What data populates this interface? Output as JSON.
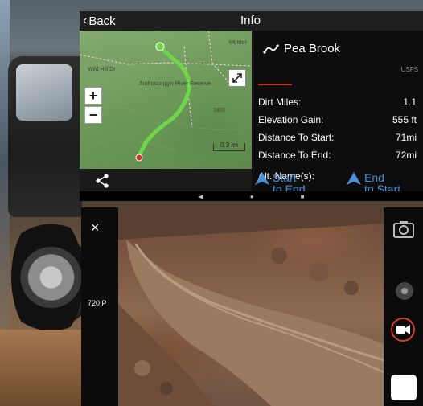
{
  "info_screen": {
    "header": {
      "back_label": "Back",
      "title": "Info"
    },
    "map": {
      "labels": [
        "Mt Mor",
        "Wild Hill Dr",
        "Androscoggin River Reserve",
        "1800"
      ],
      "zoom_in": "+",
      "zoom_out": "−",
      "scale": "0.3 mi",
      "route_color": "#6fd64a"
    },
    "route": {
      "name": "Pea Brook",
      "organization": "USFS",
      "stats": [
        {
          "label": "Dirt Miles:",
          "value": "1.1"
        },
        {
          "label": "Elevation Gain:",
          "value": "555 ft"
        },
        {
          "label": "Distance To Start:",
          "value": "71mi"
        },
        {
          "label": "Distance To End:",
          "value": "72mi"
        }
      ],
      "alt_names_label": "Alt. Name(s):"
    },
    "nav": {
      "start_to_end": [
        "Start",
        "to End"
      ],
      "end_to_start": [
        "End",
        "to Start"
      ],
      "accent": "#4a90d9"
    },
    "android_nav": [
      "◀",
      "●",
      "■"
    ]
  },
  "camera_screen": {
    "close": "×",
    "resolution": "720 P",
    "icons": [
      "camera-switch-icon",
      "photo-mode-icon",
      "video-mode-icon",
      "shutter-button"
    ],
    "record_ring_color": "#d93a2a"
  }
}
